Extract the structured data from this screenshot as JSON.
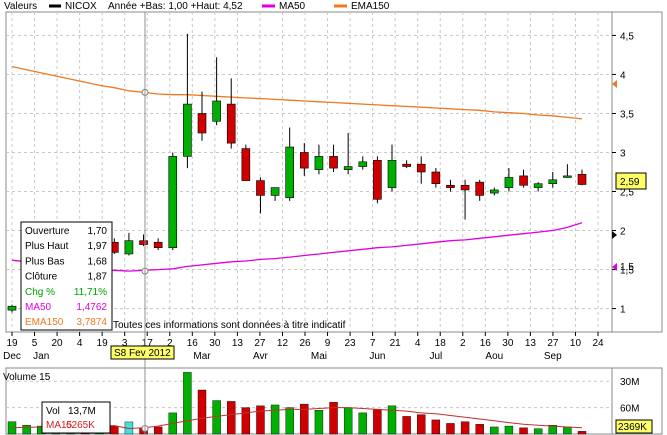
{
  "legend": {
    "label": "Valeurs",
    "items": [
      {
        "label": "NICOX",
        "color": "#000000"
      },
      {
        "label": "Année +Bas: 1,00 +Haut: 4,52",
        "color": null
      },
      {
        "label": "MA50",
        "color": "#e000e0"
      },
      {
        "label": "EMA150",
        "color": "#f07820"
      }
    ]
  },
  "disclaimer": "Toutes ces informations sont données à titre indicatif",
  "cursor_date": "S8 Fev 2012",
  "last_price_label": "2,59",
  "ma50_marker_label": "1,5",
  "info_box": {
    "rows": [
      {
        "label": "Ouverture",
        "value": "1,70",
        "color": "#000000"
      },
      {
        "label": "Plus Haut",
        "value": "1,97",
        "color": "#000000"
      },
      {
        "label": "Plus Bas",
        "value": "1,68",
        "color": "#000000"
      },
      {
        "label": "Clôture",
        "value": "1,87",
        "color": "#000000"
      },
      {
        "label": "Chg %",
        "value": "11,71%",
        "color": "#00a000"
      },
      {
        "label": "MA50",
        "value": "1,4762",
        "color": "#e000e0"
      },
      {
        "label": "EMA150",
        "value": "3,7874",
        "color": "#f07820"
      }
    ]
  },
  "volume_panel": {
    "title": "Volume 15",
    "box": [
      {
        "label": "Vol",
        "value": "13,7M",
        "color": "#000000"
      },
      {
        "label": "MA15",
        "value": "6265K",
        "color": "#d02020"
      }
    ],
    "last_label": "2369K",
    "yticks": [
      "60M",
      "30M"
    ]
  },
  "colors": {
    "up": "#00b000",
    "down": "#d00000",
    "ma50": "#e000e0",
    "ema150": "#f07820",
    "ma15": "#c03030",
    "grid": "#c8c8c8"
  },
  "chart_data": [
    {
      "type": "candlestick",
      "ylim": [
        0.7,
        4.8
      ],
      "yticks": [
        "1",
        "1,5",
        "2",
        "2,5",
        "3",
        "3,5",
        "4",
        "4,5"
      ],
      "ytick_values": [
        1,
        1.5,
        2,
        2.5,
        3,
        3.5,
        4,
        4.5
      ],
      "xticks": [
        "19",
        "5",
        "20",
        "4",
        "19",
        "3",
        "17",
        "2",
        "16",
        "30",
        "13",
        "27",
        "12",
        "26",
        "9",
        "23",
        "7",
        "21",
        "4",
        "18",
        "2",
        "16",
        "30",
        "13",
        "27",
        "10",
        "24"
      ],
      "month_labels": [
        {
          "label": "Dec",
          "index": 0
        },
        {
          "label": "Jan",
          "index": 2
        },
        {
          "label": "Mar",
          "index": 13
        },
        {
          "label": "Avr",
          "index": 17
        },
        {
          "label": "Mai",
          "index": 21
        },
        {
          "label": "Jun",
          "index": 25
        },
        {
          "label": "Jul",
          "index": 29
        },
        {
          "label": "Aou",
          "index": 33
        },
        {
          "label": "Sep",
          "index": 37
        }
      ],
      "candles": [
        {
          "o": 0.98,
          "h": 1.05,
          "l": 0.95,
          "c": 1.03
        },
        {
          "o": 1.02,
          "h": 1.15,
          "l": 0.98,
          "c": 1.1
        },
        {
          "o": 1.1,
          "h": 1.3,
          "l": 1.05,
          "c": 1.25
        },
        {
          "o": 1.25,
          "h": 1.4,
          "l": 1.15,
          "c": 1.35
        },
        {
          "o": 1.35,
          "h": 1.55,
          "l": 1.28,
          "c": 1.5
        },
        {
          "o": 1.5,
          "h": 1.6,
          "l": 1.42,
          "c": 1.47
        },
        {
          "o": 1.6,
          "h": 1.78,
          "l": 1.55,
          "c": 1.75
        },
        {
          "o": 1.85,
          "h": 1.9,
          "l": 1.7,
          "c": 1.72
        },
        {
          "o": 1.7,
          "h": 1.97,
          "l": 1.68,
          "c": 1.87
        },
        {
          "o": 1.87,
          "h": 1.95,
          "l": 1.8,
          "c": 1.82
        },
        {
          "o": 1.85,
          "h": 1.9,
          "l": 1.75,
          "c": 1.78
        },
        {
          "o": 1.78,
          "h": 3.0,
          "l": 1.75,
          "c": 2.95
        },
        {
          "o": 2.95,
          "h": 4.52,
          "l": 2.8,
          "c": 3.62
        },
        {
          "o": 3.5,
          "h": 3.78,
          "l": 3.15,
          "c": 3.25
        },
        {
          "o": 3.4,
          "h": 4.22,
          "l": 3.35,
          "c": 3.66
        },
        {
          "o": 3.62,
          "h": 3.95,
          "l": 3.05,
          "c": 3.12
        },
        {
          "o": 3.05,
          "h": 3.1,
          "l": 2.7,
          "c": 2.64
        },
        {
          "o": 2.64,
          "h": 2.68,
          "l": 2.22,
          "c": 2.45
        },
        {
          "o": 2.45,
          "h": 2.55,
          "l": 2.38,
          "c": 2.55
        },
        {
          "o": 2.42,
          "h": 3.32,
          "l": 2.38,
          "c": 3.07
        },
        {
          "o": 3.0,
          "h": 3.12,
          "l": 2.7,
          "c": 2.8
        },
        {
          "o": 2.78,
          "h": 3.1,
          "l": 2.72,
          "c": 2.95
        },
        {
          "o": 2.95,
          "h": 3.1,
          "l": 2.75,
          "c": 2.8
        },
        {
          "o": 2.78,
          "h": 3.25,
          "l": 2.72,
          "c": 2.82
        },
        {
          "o": 2.82,
          "h": 2.95,
          "l": 2.78,
          "c": 2.88
        },
        {
          "o": 2.9,
          "h": 2.95,
          "l": 2.35,
          "c": 2.4
        },
        {
          "o": 2.55,
          "h": 3.1,
          "l": 2.5,
          "c": 2.9
        },
        {
          "o": 2.85,
          "h": 2.9,
          "l": 2.8,
          "c": 2.82
        },
        {
          "o": 2.85,
          "h": 2.95,
          "l": 2.6,
          "c": 2.75
        },
        {
          "o": 2.75,
          "h": 2.8,
          "l": 2.55,
          "c": 2.6
        },
        {
          "o": 2.58,
          "h": 2.65,
          "l": 2.5,
          "c": 2.55
        },
        {
          "o": 2.58,
          "h": 2.65,
          "l": 2.14,
          "c": 2.52
        },
        {
          "o": 2.62,
          "h": 2.65,
          "l": 2.38,
          "c": 2.45
        },
        {
          "o": 2.48,
          "h": 2.55,
          "l": 2.45,
          "c": 2.52
        },
        {
          "o": 2.55,
          "h": 2.8,
          "l": 2.5,
          "c": 2.68
        },
        {
          "o": 2.7,
          "h": 2.78,
          "l": 2.55,
          "c": 2.58
        },
        {
          "o": 2.55,
          "h": 2.62,
          "l": 2.5,
          "c": 2.6
        },
        {
          "o": 2.6,
          "h": 2.75,
          "l": 2.55,
          "c": 2.65
        },
        {
          "o": 2.68,
          "h": 2.85,
          "l": 2.68,
          "c": 2.7
        },
        {
          "o": 2.72,
          "h": 2.78,
          "l": 2.58,
          "c": 2.59
        }
      ],
      "ma50": [
        1.62,
        1.6,
        1.58,
        1.56,
        1.53,
        1.5,
        1.49,
        1.49,
        1.48,
        1.49,
        1.5,
        1.51,
        1.54,
        1.56,
        1.58,
        1.6,
        1.61,
        1.63,
        1.64,
        1.66,
        1.68,
        1.7,
        1.72,
        1.74,
        1.76,
        1.78,
        1.79,
        1.81,
        1.83,
        1.85,
        1.87,
        1.88,
        1.9,
        1.92,
        1.94,
        1.96,
        1.98,
        2.0,
        2.04,
        2.1
      ],
      "ema150": [
        4.1,
        4.06,
        4.02,
        3.98,
        3.94,
        3.9,
        3.86,
        3.83,
        3.79,
        3.77,
        3.75,
        3.74,
        3.74,
        3.73,
        3.72,
        3.71,
        3.7,
        3.69,
        3.68,
        3.67,
        3.66,
        3.65,
        3.64,
        3.63,
        3.62,
        3.61,
        3.6,
        3.59,
        3.58,
        3.57,
        3.56,
        3.55,
        3.54,
        3.52,
        3.51,
        3.5,
        3.48,
        3.47,
        3.45,
        3.43
      ]
    },
    {
      "type": "bar",
      "ylim": [
        0,
        75
      ],
      "ytick_values": [
        30,
        60
      ],
      "volume": [
        14,
        10,
        9,
        12,
        13,
        11,
        16,
        9,
        13.7,
        7,
        8,
        24,
        70,
        50,
        38,
        37,
        30,
        32,
        33,
        30,
        34,
        27,
        36,
        30,
        24,
        28,
        32,
        20,
        22,
        16,
        12,
        14,
        11,
        8,
        9,
        7,
        6,
        10,
        8,
        3
      ],
      "ma15": [
        7,
        7.5,
        8,
        8.5,
        9,
        9,
        9.5,
        9.5,
        6.3,
        7,
        9,
        12,
        15,
        18,
        20,
        22,
        24,
        26,
        27,
        28,
        28,
        29,
        30,
        30,
        29,
        28,
        27,
        26,
        24,
        23,
        21,
        19,
        17,
        15,
        13,
        11,
        10,
        9,
        8,
        7
      ]
    }
  ]
}
